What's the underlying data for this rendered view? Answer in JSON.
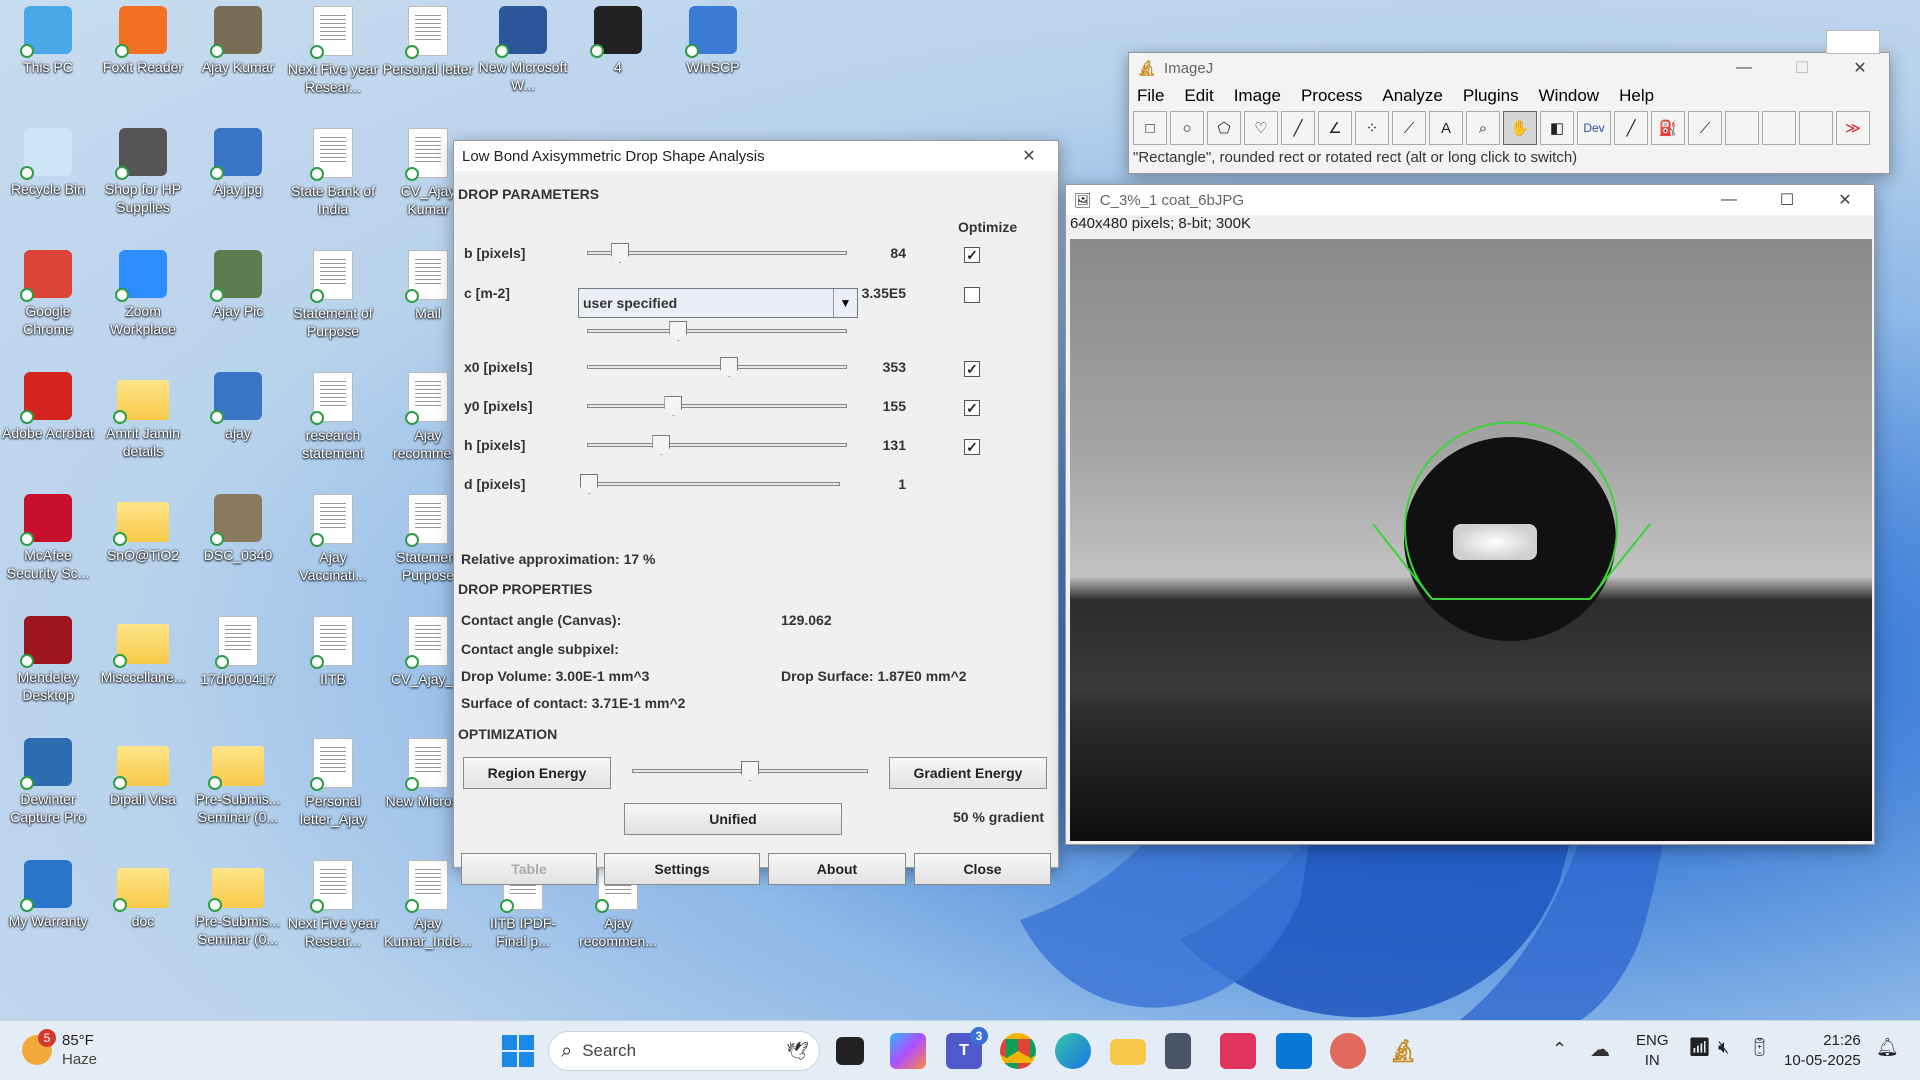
{
  "desktop": {
    "icons": [
      {
        "label": "This PC",
        "icon": "monitor-icon",
        "color": "#4aa8e8"
      },
      {
        "label": "Foxit Reader",
        "icon": "foxit-pdf-icon",
        "color": "#f36f21"
      },
      {
        "label": "Ajay Kumar",
        "icon": "photo-icon",
        "color": "#7a6c55"
      },
      {
        "label": "Next Five year Resear...",
        "icon": "document-icon",
        "color": "#ffffff"
      },
      {
        "label": "Personal letter",
        "icon": "document-icon",
        "color": "#ffffff"
      },
      {
        "label": "New Microsoft W...",
        "icon": "word-icon",
        "color": "#2b579a"
      },
      {
        "label": "4",
        "icon": "drop-image-icon",
        "color": "#222222"
      },
      {
        "label": "WinSCP",
        "icon": "winscp-icon",
        "color": "#3a7bd5"
      },
      {
        "label": "Recycle Bin",
        "icon": "recycle-bin-icon",
        "color": "#cfe4f6"
      },
      {
        "label": "Shop for HP Supplies",
        "icon": "printer-icon",
        "color": "#555555"
      },
      {
        "label": "Ajay.jpg",
        "icon": "photo-icon",
        "color": "#3a74c4"
      },
      {
        "label": "State Bank of India",
        "icon": "document-icon",
        "color": "#ffffff"
      },
      {
        "label": "CV_Ajay Kumar",
        "icon": "document-icon",
        "color": "#ffffff"
      },
      {
        "label": "Google Chrome",
        "icon": "chrome-icon",
        "color": "#db4437"
      },
      {
        "label": "Zoom Workplace",
        "icon": "zoom-icon",
        "color": "#2d8cff"
      },
      {
        "label": "Ajay Pic",
        "icon": "photo-icon",
        "color": "#5b7d4f"
      },
      {
        "label": "Statement of Purpose",
        "icon": "document-icon",
        "color": "#ffffff"
      },
      {
        "label": "Mail",
        "icon": "document-icon",
        "color": "#ffffff"
      },
      {
        "label": "Adobe Acrobat",
        "icon": "acrobat-icon",
        "color": "#d3241f"
      },
      {
        "label": "Amrit Jamin details",
        "icon": "folder-icon",
        "color": "#f7c948"
      },
      {
        "label": "ajay",
        "icon": "photo-icon",
        "color": "#3a74c4"
      },
      {
        "label": "research statement",
        "icon": "document-icon",
        "color": "#ffffff"
      },
      {
        "label": "Ajay recomme...",
        "icon": "document-icon",
        "color": "#ffffff"
      },
      {
        "label": "McAfee Security Sc...",
        "icon": "mcafee-icon",
        "color": "#c8102e"
      },
      {
        "label": "SnO@TiO2",
        "icon": "folder-icon",
        "color": "#f7c948"
      },
      {
        "label": "DSC_0340",
        "icon": "photo-icon",
        "color": "#8a7a60"
      },
      {
        "label": "Ajay Vaccinati...",
        "icon": "document-icon",
        "color": "#ffffff"
      },
      {
        "label": "Statement Purpose",
        "icon": "document-icon",
        "color": "#ffffff"
      },
      {
        "label": "Mendeley Desktop",
        "icon": "mendeley-icon",
        "color": "#9d1620"
      },
      {
        "label": "Misccellane...",
        "icon": "folder-icon",
        "color": "#f7c948"
      },
      {
        "label": "17dr000417",
        "icon": "document-icon",
        "color": "#ffffff"
      },
      {
        "label": "IITB",
        "icon": "document-icon",
        "color": "#ffffff"
      },
      {
        "label": "CV_Ajay_M",
        "icon": "document-icon",
        "color": "#ffffff"
      },
      {
        "label": "Dewinter Capture Pro",
        "icon": "capture-icon",
        "color": "#2f6db3"
      },
      {
        "label": "Dipali Visa",
        "icon": "folder-icon",
        "color": "#f7c948"
      },
      {
        "label": "Pre-Submis... Seminar (0...",
        "icon": "folder-icon",
        "color": "#f7c948"
      },
      {
        "label": "Personal letter_Ajay",
        "icon": "document-icon",
        "color": "#ffffff"
      },
      {
        "label": "New Microsof",
        "icon": "document-icon",
        "color": "#ffffff"
      },
      {
        "label": "My Warranty",
        "icon": "warranty-icon",
        "color": "#2a75c9"
      },
      {
        "label": "doc",
        "icon": "folder-icon",
        "color": "#f7c948"
      },
      {
        "label": "Pre-Submis... Seminar (0...",
        "icon": "folder-icon",
        "color": "#f7c948"
      },
      {
        "label": "Next Five year Resear...",
        "icon": "document-icon",
        "color": "#ffffff"
      },
      {
        "label": "Ajay Kumar_Inde...",
        "icon": "document-icon",
        "color": "#ffffff"
      },
      {
        "label": "IITB IPDF-Final p...",
        "icon": "document-icon",
        "color": "#ffffff"
      },
      {
        "label": "Ajay recommen...",
        "icon": "document-icon",
        "color": "#ffffff"
      }
    ]
  },
  "dialog": {
    "title": "Low Bond Axisymmetric Drop Shape Analysis",
    "drop_parameters_heading": "DROP PARAMETERS",
    "optimize_heading": "Optimize",
    "params": [
      {
        "label": "b [pixels]",
        "value": "84",
        "slider": 0.1,
        "optimize": true,
        "has_checkbox": true
      },
      {
        "label": "c [m-2]",
        "value": "3.35E5",
        "slider": 0.34,
        "optimize": false,
        "has_checkbox": true
      },
      {
        "label": "x0 [pixels]",
        "value": "353",
        "slider": 0.55,
        "optimize": true,
        "has_checkbox": true
      },
      {
        "label": "y0 [pixels]",
        "value": "155",
        "slider": 0.32,
        "optimize": true,
        "has_checkbox": true
      },
      {
        "label": "h [pixels]",
        "value": "131",
        "slider": 0.27,
        "optimize": true,
        "has_checkbox": true
      },
      {
        "label": "d [pixels]",
        "value": "1",
        "slider": 0.0,
        "optimize": false,
        "has_checkbox": false
      }
    ],
    "c_dropdown_value": "user specified",
    "relative_approx": "Relative approximation: 17 %",
    "drop_properties_heading": "DROP PROPERTIES",
    "contact_angle_canvas_label": "Contact angle (Canvas):",
    "contact_angle_canvas_value": "129.062",
    "contact_angle_subpixel_label": "Contact angle subpixel:",
    "drop_volume": "Drop Volume: 3.00E-1 mm^3",
    "drop_surface": "Drop Surface: 1.87E0 mm^2",
    "surface_contact": "Surface of contact: 3.71E-1 mm^2",
    "optimization_heading": "OPTIMIZATION",
    "region_energy": "Region Energy",
    "gradient_energy": "Gradient Energy",
    "optimization_slider": 0.5,
    "unified": "Unified",
    "gradient_percent": "50 % gradient",
    "table": "Table",
    "settings": "Settings",
    "about": "About",
    "close": "Close"
  },
  "imagej": {
    "title": "ImageJ",
    "menu": [
      "File",
      "Edit",
      "Image",
      "Process",
      "Analyze",
      "Plugins",
      "Window",
      "Help"
    ],
    "tools": [
      "rectangle-tool-icon",
      "oval-tool-icon",
      "polygon-tool-icon",
      "freehand-tool-icon",
      "line-tool-icon",
      "angle-tool-icon",
      "point-tool-icon",
      "wand-tool-icon",
      "text-tool-icon",
      "magnifier-tool-icon",
      "hand-tool-icon",
      "color-picker-tool-icon",
      "dev-tool-icon",
      "brush-tool-icon",
      "flood-fill-tool-icon",
      "pipette-tool-icon",
      "blank-tool-icon",
      "blank-tool-icon",
      "blank-tool-icon",
      "more-tools-icon"
    ],
    "tool_glyphs": [
      "□",
      "○",
      "⬠",
      "♡",
      "╱",
      "∠",
      "⁘",
      "⟋",
      "A",
      "⌕",
      "✋",
      "◧",
      "Dev",
      "╱",
      "⛽",
      "⟋",
      "",
      "",
      "",
      "≫"
    ],
    "status": "\"Rectangle\", rounded rect or rotated rect (alt or long click to switch)"
  },
  "image_window": {
    "title": "C_3%_1 coat_6bJPG",
    "info": "640x480 pixels; 8-bit; 300K"
  },
  "taskbar": {
    "weather_badge": "5",
    "temperature": "85°F",
    "condition": "Haze",
    "search_placeholder": "Search",
    "teams_badge": "3",
    "language": "ENG",
    "region": "IN",
    "time": "21:26",
    "date": "10-05-2025"
  }
}
